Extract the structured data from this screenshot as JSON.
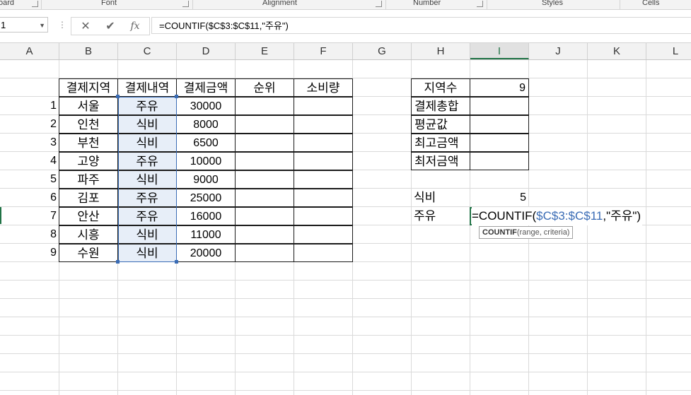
{
  "ribbon_groups": [
    {
      "label": "oard"
    },
    {
      "label": "Font"
    },
    {
      "label": "Alignment"
    },
    {
      "label": "Number"
    },
    {
      "label": "Styles"
    },
    {
      "label": "Cells"
    }
  ],
  "formula_bar": {
    "name_box": "1",
    "cancel_glyph": "✕",
    "enter_glyph": "✔",
    "fx_glyph": "fx",
    "formula": "=COUNTIF($C$3:$C$11,\"주유\")"
  },
  "columns": [
    "A",
    "B",
    "C",
    "D",
    "E",
    "F",
    "G",
    "H",
    "I",
    "J",
    "K",
    "L"
  ],
  "active_column": "I",
  "table": {
    "headers": [
      "결제지역",
      "결제내역",
      "결제금액",
      "순위",
      "소비량"
    ],
    "rows": [
      {
        "no": "1",
        "region": "서울",
        "item": "주유",
        "amount": "30000"
      },
      {
        "no": "2",
        "region": "인천",
        "item": "식비",
        "amount": "8000"
      },
      {
        "no": "3",
        "region": "부천",
        "item": "식비",
        "amount": "6500"
      },
      {
        "no": "4",
        "region": "고양",
        "item": "주유",
        "amount": "10000"
      },
      {
        "no": "5",
        "region": "파주",
        "item": "식비",
        "amount": "9000"
      },
      {
        "no": "6",
        "region": "김포",
        "item": "주유",
        "amount": "25000"
      },
      {
        "no": "7",
        "region": "안산",
        "item": "주유",
        "amount": "16000"
      },
      {
        "no": "8",
        "region": "시흥",
        "item": "식비",
        "amount": "11000"
      },
      {
        "no": "9",
        "region": "수원",
        "item": "식비",
        "amount": "20000"
      }
    ]
  },
  "summary": [
    {
      "label": "지역수",
      "value": "9"
    },
    {
      "label": "결제총합",
      "value": ""
    },
    {
      "label": "평균값",
      "value": ""
    },
    {
      "label": "최고금액",
      "value": ""
    },
    {
      "label": "최저금액",
      "value": ""
    }
  ],
  "counts": {
    "food_label": "식비",
    "food_value": "5",
    "fuel_label": "주유"
  },
  "editing": {
    "prefix": "=COUNTIF(",
    "range_ref": "$C$3:$C$11",
    "suffix": ",\"주유\")"
  },
  "tooltip": {
    "func": "COUNTIF",
    "args": "(range, criteria)"
  },
  "colors": {
    "accent": "#217346",
    "reference": "#3a6cb5",
    "selection_fill": "#e7eef8"
  }
}
